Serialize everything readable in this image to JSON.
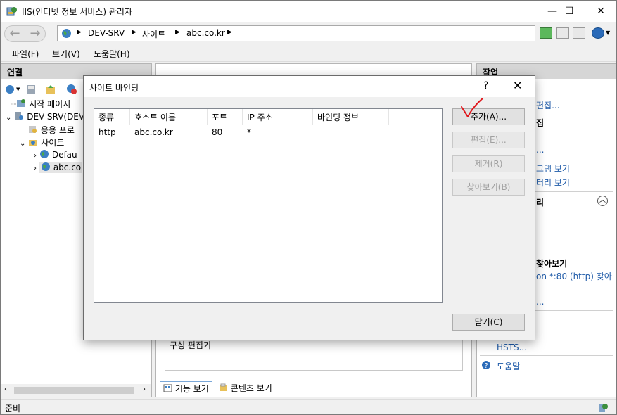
{
  "window": {
    "title": "IIS(인터넷 정보 서비스) 관리자",
    "controls": {
      "minimize": "—",
      "maximize": "☐",
      "close": "✕"
    }
  },
  "address": {
    "crumbs": [
      "DEV-SRV",
      "사이트",
      "abc.co.kr"
    ]
  },
  "menu": {
    "items": [
      "파일(F)",
      "보기(V)",
      "도움말(H)"
    ]
  },
  "connections": {
    "header": "연결",
    "tree": [
      {
        "label": "시작 페이지"
      },
      {
        "label": "DEV-SRV(DEV"
      },
      {
        "label": "응용 프로"
      },
      {
        "label": "사이트"
      },
      {
        "label": "Defau"
      },
      {
        "label": "abc.co"
      }
    ]
  },
  "center": {
    "editor_group": "구성 편집기",
    "tabs": {
      "feature_view": "기능 보기",
      "content_view": "콘텐츠 보기"
    }
  },
  "actions": {
    "header": "작업",
    "items": {
      "edit": "편집...",
      "bind": "집",
      "dots": "...",
      "view_apps": "그램 보기",
      "view_dirs": "터리 보기",
      "section_manage": "리",
      "browse_head": "찾아보기",
      "browse_site": "on *:80 (http) 찾아",
      "dots2": "...",
      "hsts": "HSTS...",
      "help": "도움말"
    }
  },
  "status": {
    "text": "준비"
  },
  "dialog": {
    "title": "사이트 바인딩",
    "help": "?",
    "close": "✕",
    "columns": [
      "종류",
      "호스트 이름",
      "포트",
      "IP 주소",
      "바인딩 정보"
    ],
    "rows": [
      {
        "type": "http",
        "host": "abc.co.kr",
        "port": "80",
        "ip": "*",
        "info": ""
      }
    ],
    "buttons": {
      "add": "추가(A)...",
      "edit": "편집(E)...",
      "remove": "제거(R)",
      "browse": "찾아보기(B)",
      "close": "닫기(C)"
    }
  },
  "colors": {
    "link": "#1e5aa8",
    "checkmark": "#e0161b",
    "pane_header": "#d6d6d6"
  }
}
